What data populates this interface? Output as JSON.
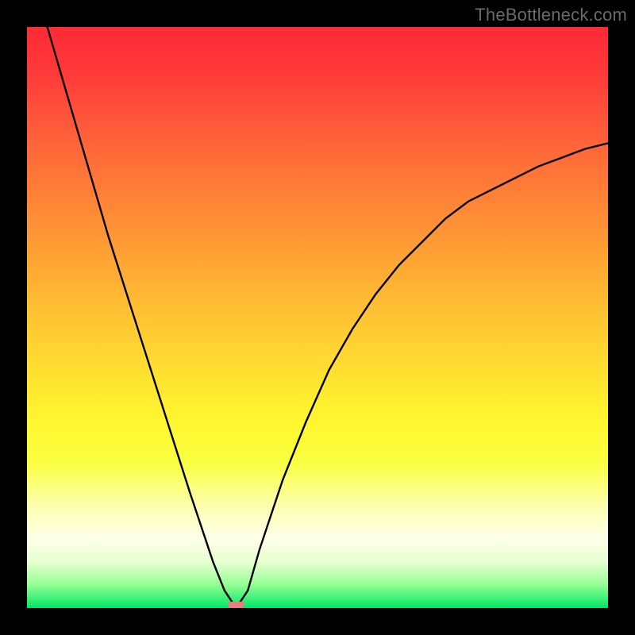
{
  "watermark": "TheBottleneck.com",
  "chart_data": {
    "type": "line",
    "title": "",
    "xlabel": "",
    "ylabel": "",
    "xlim": [
      0,
      100
    ],
    "ylim": [
      0,
      100
    ],
    "series": [
      {
        "name": "bottleneck-curve",
        "x": [
          0,
          3.5,
          7,
          10.5,
          14,
          17.5,
          21,
          24.5,
          28,
          30,
          32,
          34,
          36,
          38,
          40,
          44,
          48,
          52,
          56,
          60,
          64,
          68,
          72,
          76,
          80,
          84,
          88,
          92,
          96,
          100
        ],
        "values": [
          115,
          100,
          88,
          76,
          64,
          53,
          42,
          31,
          20,
          14,
          8,
          3,
          0,
          3,
          10,
          22,
          32,
          41,
          48,
          54,
          59,
          63,
          67,
          70,
          72,
          74,
          76,
          77.5,
          79,
          80
        ]
      }
    ],
    "annotations": [
      {
        "name": "min-marker",
        "x": 36,
        "y": 0,
        "width_pct": 3
      }
    ],
    "background_gradient_stops": [
      {
        "pct": 0,
        "color": "#ff2a36"
      },
      {
        "pct": 50,
        "color": "#ffd431"
      },
      {
        "pct": 88,
        "color": "#ffffe9"
      },
      {
        "pct": 100,
        "color": "#00e765"
      }
    ]
  },
  "colors": {
    "curve": "#000000",
    "marker": "#e77f7d",
    "frame": "#000000"
  }
}
